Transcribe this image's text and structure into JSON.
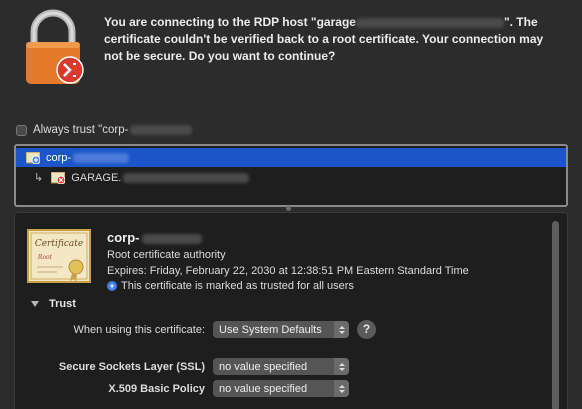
{
  "header": {
    "message_part1": "You are connecting to the RDP host \"garage",
    "message_part2": "\". The certificate couldn't be verified back to a root certificate. Your connection may not be secure. Do you want to continue?"
  },
  "always_trust": {
    "label": "Always trust \"corp-",
    "checked": false
  },
  "chain": {
    "items": [
      {
        "label": "corp-",
        "selected": true
      },
      {
        "label": "GARAGE.",
        "selected": false
      }
    ]
  },
  "details": {
    "cert_icon_text": "Certificate",
    "cert_icon_subtext": "Root",
    "name": "corp-",
    "type": "Root certificate authority",
    "expires": "Expires: Friday, February 22, 2030 at 12:38:51 PM Eastern Standard Time",
    "trusted_note": "This certificate is marked as trusted for all users",
    "trust_section": "Trust",
    "when_using_label": "When using this certificate:",
    "when_using_value": "Use System Defaults",
    "ssl_label": "Secure Sockets Layer (SSL)",
    "ssl_value": "no value specified",
    "x509_label": "X.509 Basic Policy",
    "x509_value": "no value specified",
    "help_label": "?"
  },
  "colors": {
    "selection": "#1b55c8",
    "lock_orange": "#e57a2d",
    "badge_red": "#d83a2c"
  }
}
